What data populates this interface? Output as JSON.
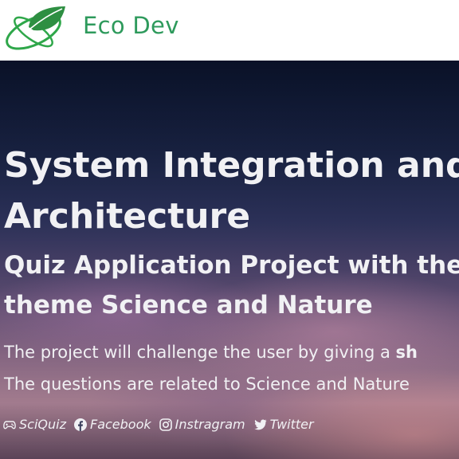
{
  "header": {
    "brand": "Eco Dev",
    "logo_icon": "leaf-orbit-logo"
  },
  "hero": {
    "title_line1": "System Integration and",
    "title_line2": "Architecture",
    "subtitle_line1": "Quiz Application Project with the",
    "subtitle_line2": "theme Science and Nature",
    "desc_line1_prefix": "The project will challenge the user by giving a ",
    "desc_line1_bold": "sh",
    "desc_line2": "The questions are related to Science and Nature"
  },
  "links": [
    {
      "label": "SciQuiz",
      "icon": "gamepad-icon"
    },
    {
      "label": "Facebook",
      "icon": "facebook-icon"
    },
    {
      "label": "Instragram",
      "icon": "instagram-icon"
    },
    {
      "label": "Twitter",
      "icon": "twitter-icon"
    }
  ],
  "colors": {
    "brand": "#2e9a5c",
    "text_light": "#f1f1f4"
  }
}
